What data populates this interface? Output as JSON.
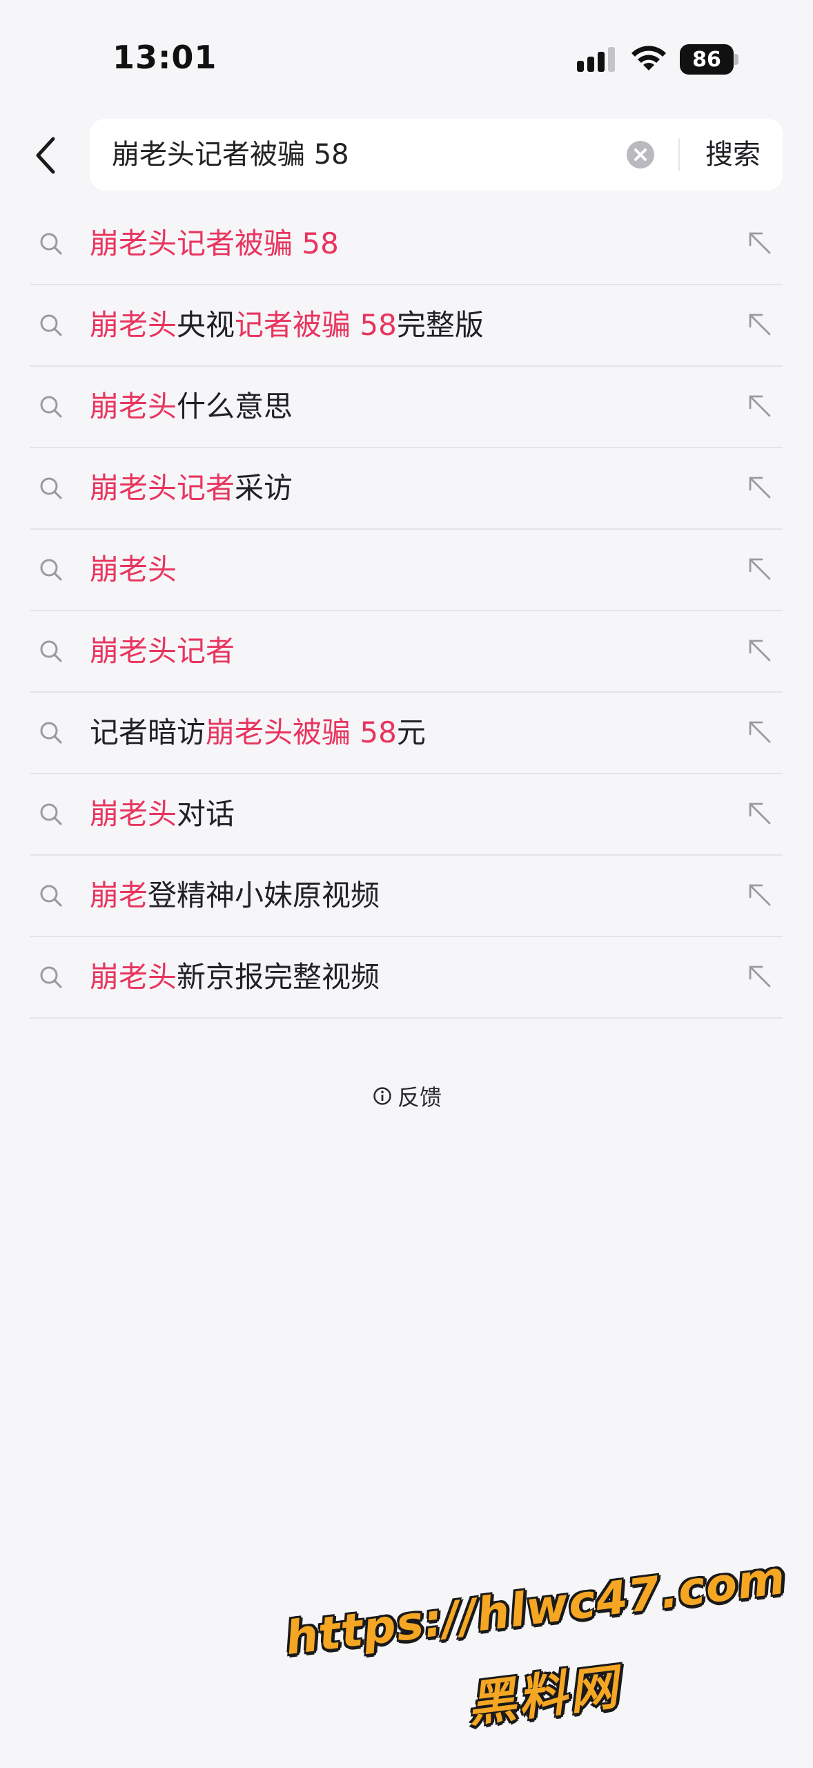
{
  "status_bar": {
    "time": "13:01",
    "battery": "86"
  },
  "search": {
    "query": "崩老头记者被骗 58",
    "button_label": "搜索"
  },
  "suggestions": [
    {
      "segments": [
        {
          "text": "崩老头记者被骗 58",
          "hl": true
        }
      ]
    },
    {
      "segments": [
        {
          "text": "崩老头",
          "hl": true
        },
        {
          "text": "央视",
          "hl": false
        },
        {
          "text": "记者被骗 58",
          "hl": true
        },
        {
          "text": "完整版",
          "hl": false
        }
      ]
    },
    {
      "segments": [
        {
          "text": "崩老头",
          "hl": true
        },
        {
          "text": "什么意思",
          "hl": false
        }
      ]
    },
    {
      "segments": [
        {
          "text": "崩老头记者",
          "hl": true
        },
        {
          "text": "采访",
          "hl": false
        }
      ]
    },
    {
      "segments": [
        {
          "text": "崩老头",
          "hl": true
        }
      ]
    },
    {
      "segments": [
        {
          "text": "崩老头记者",
          "hl": true
        }
      ]
    },
    {
      "segments": [
        {
          "text": "记者暗访",
          "hl": false
        },
        {
          "text": "崩老头被骗 58",
          "hl": true
        },
        {
          "text": "元",
          "hl": false
        }
      ]
    },
    {
      "segments": [
        {
          "text": "崩老头",
          "hl": true
        },
        {
          "text": "对话",
          "hl": false
        }
      ]
    },
    {
      "segments": [
        {
          "text": "崩老",
          "hl": true
        },
        {
          "text": "登精神小妹原视频",
          "hl": false
        }
      ]
    },
    {
      "segments": [
        {
          "text": "崩老头",
          "hl": true
        },
        {
          "text": "新京报完整视频",
          "hl": false
        }
      ]
    }
  ],
  "feedback": {
    "label": "反馈"
  },
  "watermark": {
    "url": "https://hlwc47.com",
    "name": "黑料网"
  },
  "colors": {
    "highlight": "#e8355f",
    "text": "#202026",
    "background": "#f6f6f8",
    "watermark": "#f5a623"
  },
  "icons": {
    "back": "chevron-left-icon",
    "clear": "clear-circle-icon",
    "search": "search-icon",
    "fill": "arrow-up-left-icon",
    "info": "info-icon"
  }
}
